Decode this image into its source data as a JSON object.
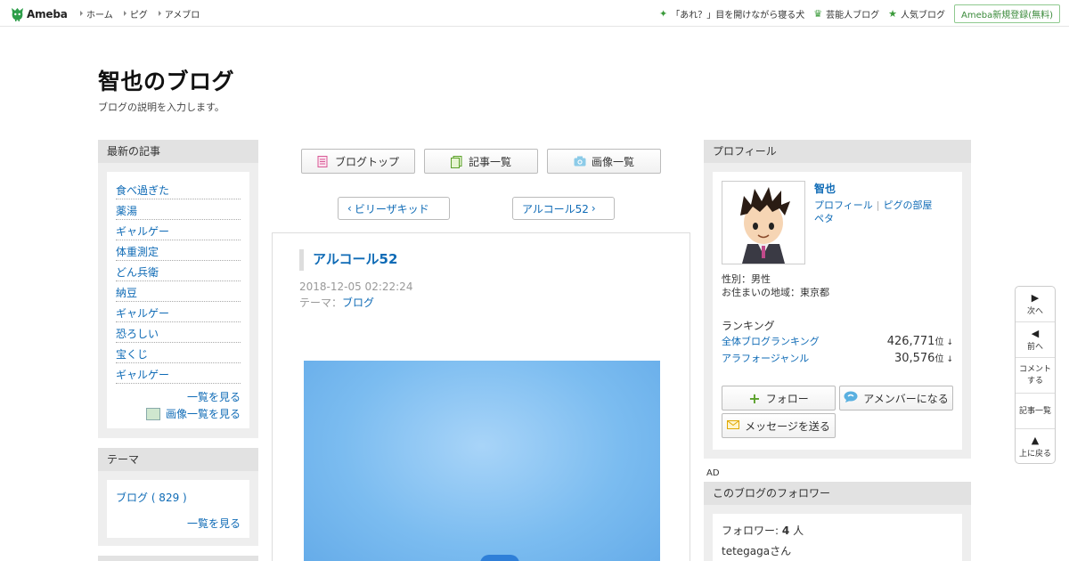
{
  "header": {
    "logo_text": "Ameba",
    "nav": [
      "ホーム",
      "ピグ",
      "アメブロ"
    ],
    "right_links": [
      {
        "icon": "sparkle-icon",
        "label": "「あれ？」目を開けながら寝る犬"
      },
      {
        "icon": "crown-icon",
        "label": "芸能人ブログ"
      },
      {
        "icon": "star-icon",
        "label": "人気ブログ"
      }
    ],
    "register_label": "Ameba新規登録(無料)"
  },
  "blog": {
    "title": "智也のブログ",
    "description": "ブログの説明を入力します。"
  },
  "recent": {
    "heading": "最新の記事",
    "items": [
      "食べ過ぎた",
      "薬湯",
      "ギャルゲー",
      "体重測定",
      "どん兵衛",
      "納豆",
      "ギャルゲー",
      "恐ろしい",
      "宝くじ",
      "ギャルゲー"
    ],
    "more_label": "一覧を見る",
    "images_label": "画像一覧を見る"
  },
  "theme_box": {
    "heading": "テーマ",
    "item": "ブログ ( 829 )",
    "more_label": "一覧を見る"
  },
  "toolbar": {
    "blog_top": "ブログトップ",
    "article_list": "記事一覧",
    "image_list": "画像一覧"
  },
  "pager": {
    "prev": "ビリーザキッド",
    "next": "アルコール52"
  },
  "article": {
    "title": "アルコール52",
    "date": "2018-12-05 02:22:24",
    "theme_prefix": "テーマ：",
    "theme": "ブログ"
  },
  "profile": {
    "heading": "プロフィール",
    "name": "智也",
    "link_profile": "プロフィール",
    "link_room": "ピグの部屋",
    "link_peta": "ペタ",
    "gender": "性別：男性",
    "area": "お住まいの地域：東京都",
    "ranking_heading": "ランキング",
    "rank_overall_label": "全体ブログランキング",
    "rank_overall_value": "426,771",
    "rank_genre_label": "アラフォージャンル",
    "rank_genre_value": "30,576",
    "rank_unit": "位",
    "follow_label": "フォロー",
    "member_label": "アメンバーになる",
    "message_label": "メッセージを送る"
  },
  "ad_label": "AD",
  "followers": {
    "heading": "このブログのフォロワー",
    "count_prefix": "フォロワー:",
    "count": "4",
    "count_suffix": "人",
    "first": "tetegagaさん"
  },
  "sidenav": {
    "next": "次へ",
    "prev": "前へ",
    "comment": "コメントする",
    "list": "記事一覧",
    "top": "上に戻る"
  },
  "colors": {
    "link": "#0f6bb6",
    "header_green": "#3a9a3a",
    "sidebar_bg": "#eeeeee"
  }
}
